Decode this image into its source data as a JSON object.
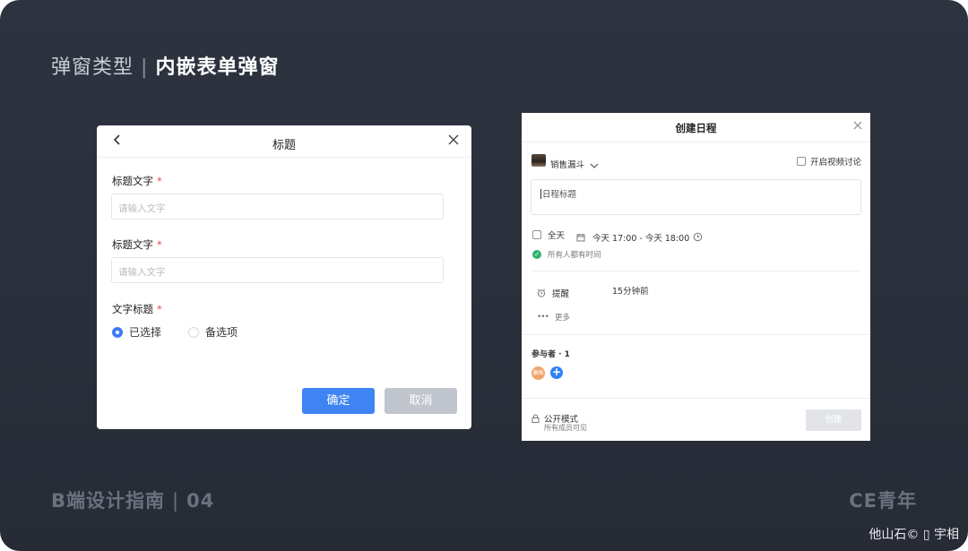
{
  "page": {
    "heading_prefix": "弹窗类型",
    "heading_separator": "|",
    "heading_main": "内嵌表单弹窗",
    "footer_left_text": "B端设计指南",
    "footer_left_separator": "|",
    "footer_left_number": "04",
    "footer_right": "CE青年",
    "credit": "他山石© ▯ 宇相"
  },
  "form_modal": {
    "title": "标题",
    "back_icon": "chevron-left-icon",
    "close_icon": "close-icon",
    "fields": [
      {
        "label": "标题文字",
        "required_mark": "*",
        "placeholder": "请输入文字"
      },
      {
        "label": "标题文字",
        "required_mark": "*",
        "placeholder": "请输入文字"
      }
    ],
    "radio_group": {
      "label": "文字标题",
      "required_mark": "*",
      "options": [
        {
          "label": "已选择",
          "checked": true
        },
        {
          "label": "备选项",
          "checked": false
        }
      ]
    },
    "confirm_label": "确定",
    "cancel_label": "取消",
    "colors": {
      "primary": "#3f84f3",
      "muted": "#c0c5ce",
      "required": "#e84a4a"
    }
  },
  "schedule_modal": {
    "title": "创建日程",
    "close_icon": "close-icon",
    "calendar_name": "销售漏斗",
    "video_label": "开启视频讨论",
    "title_placeholder": "日程标题",
    "allday_label": "全天",
    "time_range": "今天 17:00 - 今天 18:00",
    "availability": "所有人都有时间",
    "reminder_label": "提醒",
    "reminder_value": "15分钟前",
    "more_label": "更多",
    "participants_label": "参与者 · 1",
    "avatar_text": "康格",
    "public_label": "公开模式",
    "public_desc": "所有成员可见",
    "create_label": "创建",
    "colors": {
      "success": "#2fb36b",
      "add": "#2f83f2",
      "avatar": "#f0a46c"
    }
  }
}
